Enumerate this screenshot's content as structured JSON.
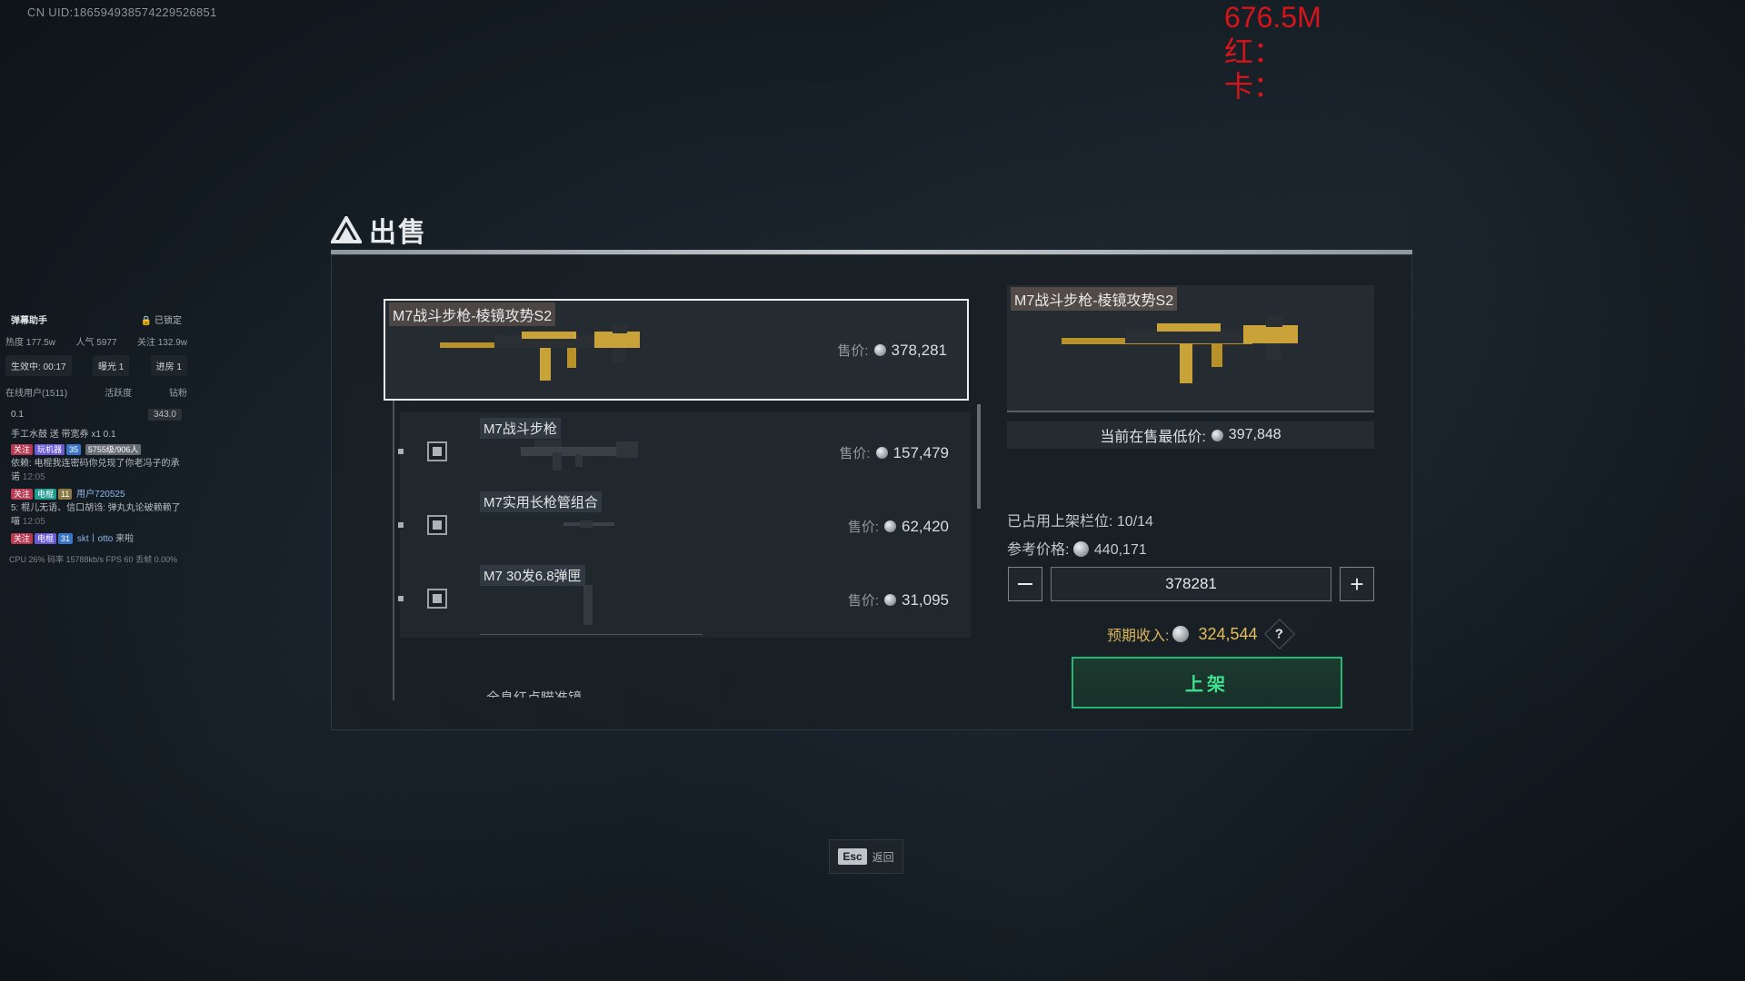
{
  "uid_text": "CN UID:1865949385742295268​51",
  "overlay": {
    "value": "676.5M",
    "red_label": "红：",
    "card_label": "卡："
  },
  "stream_panel": {
    "title": "弹幕助手",
    "lock_status": "已锁定",
    "stats": [
      "热度 177.5w",
      "人气 5977",
      "关注 132.9w"
    ],
    "buttons": [
      "生效中: 00:17",
      "曝光 1",
      "进房 1"
    ],
    "tabs": [
      "在线用户(1511)",
      "活跃度",
      "钻粉"
    ],
    "coin_left": "0.1",
    "coin_right": "343.0",
    "gift_line": "手工水鼓 送 带宽券 x1 0.1",
    "messages": [
      {
        "tags": [
          "关注",
          "玩机器",
          "35"
        ],
        "user": "5755级/906人",
        "text": "依赖: 电棍我连密码你兑现了你老冯子的承诺",
        "time": "12:05"
      },
      {
        "tags": [
          "关注",
          "电棍",
          "11"
        ],
        "user": "用户720525",
        "text": "5: 棍儿无语、信口胡诌: 弹丸丸论破赖赖了喵",
        "time": "12:05"
      },
      {
        "tags": [
          "关注",
          "电棍",
          "31"
        ],
        "user": "skt丨otto",
        "text": "来啦",
        "time": ""
      }
    ],
    "cpu_line": "CPU 26%  码率 15788kb/s  FPS 60  丢帧 0.00%"
  },
  "dialog": {
    "title": "出售",
    "selected_item": {
      "name": "M7战斗步枪-棱镜攻势S2",
      "price_label": "售价:",
      "price": "378,281"
    },
    "items": [
      {
        "name": "M7战斗步枪",
        "price_label": "售价:",
        "price": "157,479"
      },
      {
        "name": "M7实用长枪管组合",
        "price_label": "售价:",
        "price": "62,420"
      },
      {
        "name": "M7 30发6.8弹匣",
        "price_label": "售价:",
        "price": "31,095"
      }
    ],
    "partial_item_name": "全息红点瞄准镜",
    "preview_name": "M7战斗步枪-棱镜攻势S2",
    "lowest_label": "当前在售最低价:",
    "lowest_price": "397,848",
    "slots_label": "已占用上架栏位:",
    "slots_value": "10/14",
    "ref_label": "参考价格:",
    "ref_price": "440,171",
    "price_input_value": "378281",
    "income_label": "预期收入:",
    "income_value": "324,544",
    "list_button": "上架"
  },
  "footer": {
    "esc_key": "Esc",
    "esc_label": "返回"
  },
  "colors": {
    "accent_green": "#25b872",
    "income_gold": "#e6bd57",
    "overlay_red": "#d5151b"
  }
}
